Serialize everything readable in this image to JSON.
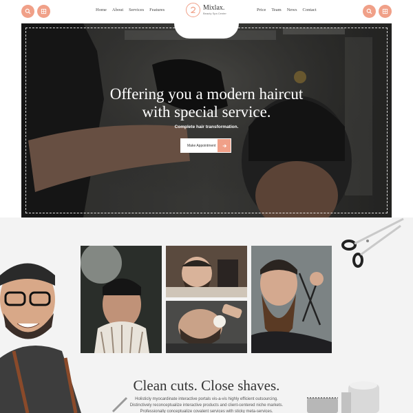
{
  "header": {
    "nav_left": [
      "Home",
      "About",
      "Services",
      "Features"
    ],
    "nav_right": [
      "Price",
      "Team",
      "News",
      "Contact"
    ],
    "logo_name": "Mixlax.",
    "logo_tagline": "Beauty Spa Center",
    "buttons": {
      "left": [
        "search-icon",
        "grid-icon"
      ],
      "right": [
        "search-icon",
        "grid-icon"
      ]
    }
  },
  "hero": {
    "title_line1": "Offering you a modern haircut",
    "title_line2": "with special service.",
    "subtitle": "Complete hair transformation.",
    "cta_label": "Make Appointment",
    "cta_icon": "arrow-right-icon"
  },
  "section": {
    "title": "Clean cuts. Close shaves.",
    "body": "Holisticly myocardinate interactive portals vis-a-vis highly efficient outsourcing. Distinctively reconceptualize interactive products and client-centered niche markets. Professionally conceptualize covalent services with sticky meta-services."
  },
  "colors": {
    "accent": "#f0a088",
    "hero_overlay": "#1c1c1c",
    "section_bg": "#f3f3f3"
  }
}
